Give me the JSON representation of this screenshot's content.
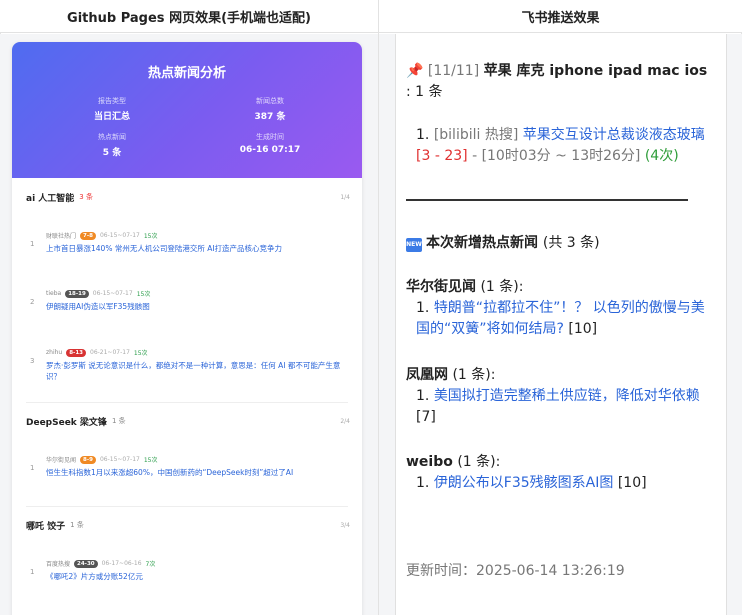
{
  "headers": {
    "left": "Github Pages 网页效果(手机端也适配)",
    "right": "飞书推送效果"
  },
  "web": {
    "hero_title": "热点新闻分析",
    "stats": [
      {
        "label": "报告类型",
        "value": "当日汇总"
      },
      {
        "label": "新闻总数",
        "value": "387 条"
      },
      {
        "label": "热点新闻",
        "value": "5 条"
      },
      {
        "label": "生成时间",
        "value": "06-16 07:17"
      }
    ],
    "groups": [
      {
        "name": "ai 人工智能",
        "count": "3 条",
        "index": "1/4",
        "items": [
          {
            "num": "1",
            "source": "财联社热门",
            "badge": "7-8",
            "time": "06-15~07-17",
            "count": "15次",
            "title": "上市首日暴涨140% 常州无人机公司登陆港交所 AI打造产品核心竞争力"
          },
          {
            "num": "2",
            "source": "tieba",
            "badge": "18-19",
            "time": "06-15~07-17",
            "count": "15次",
            "title": "伊朗疑用AI伪造以军F35残骸图"
          },
          {
            "num": "3",
            "source": "zhihu",
            "badge": "8-13",
            "time": "06-21~07-17",
            "count": "15次",
            "title": "罗杰·彭罗斯 说无论意识是什么，都绝对不是一种计算，意思是：任何 AI 都不可能产生意识？"
          }
        ]
      },
      {
        "name": "DeepSeek 梁文锋",
        "count": "1 条",
        "index": "2/4",
        "items": [
          {
            "num": "1",
            "source": "华尔街见闻",
            "badge": "8-9",
            "time": "06-15~07-17",
            "count": "15次",
            "title": "恒生生科指数1月以来涨超60%，中国创新药的“DeepSeek时刻”超过了AI"
          }
        ]
      },
      {
        "name": "哪吒 饺子",
        "count": "1 条",
        "index": "3/4",
        "items": [
          {
            "num": "1",
            "source": "百度热搜",
            "badge": "24-30",
            "time": "06-17~06-16",
            "count": "7次",
            "title": "《哪吒2》片方或分账52亿元"
          }
        ]
      }
    ]
  },
  "feishu": {
    "pin_header": {
      "icon": "📌",
      "index": "[11/11]",
      "keywords": "苹果 库克 iphone ipad mac ios",
      "suffix": " : 1 条"
    },
    "pin_item": {
      "num": "1.",
      "source": "[bilibili 热搜]",
      "title": "苹果交互设计总裁谈液态玻璃",
      "rank": "[3 - 23]",
      "time": "- [10时03分 ~ 13时26分]",
      "count": "(4次)"
    },
    "new_section": {
      "icon": "NEW",
      "title": "本次新增热点新闻",
      "count": "(共 3 条)"
    },
    "sources": [
      {
        "name": "华尔街见闻",
        "count": "(1 条):",
        "num": "1.",
        "title": "特朗普“拉都拉不住”！？ 以色列的傲慢与美国的“双簧”将如何结局?",
        "rank": "[10]"
      },
      {
        "name": "凤凰网",
        "count": "(1 条):",
        "num": "1.",
        "title": "美国拟打造完整稀土供应链，降低对华依赖",
        "rank": "[7]"
      },
      {
        "name": "weibo",
        "count": "(1 条):",
        "num": "1.",
        "title": "伊朗公布以F35残骸图系AI图",
        "rank": "[10]"
      }
    ],
    "update_time": "更新时间：2025-06-14 13:26:19"
  }
}
